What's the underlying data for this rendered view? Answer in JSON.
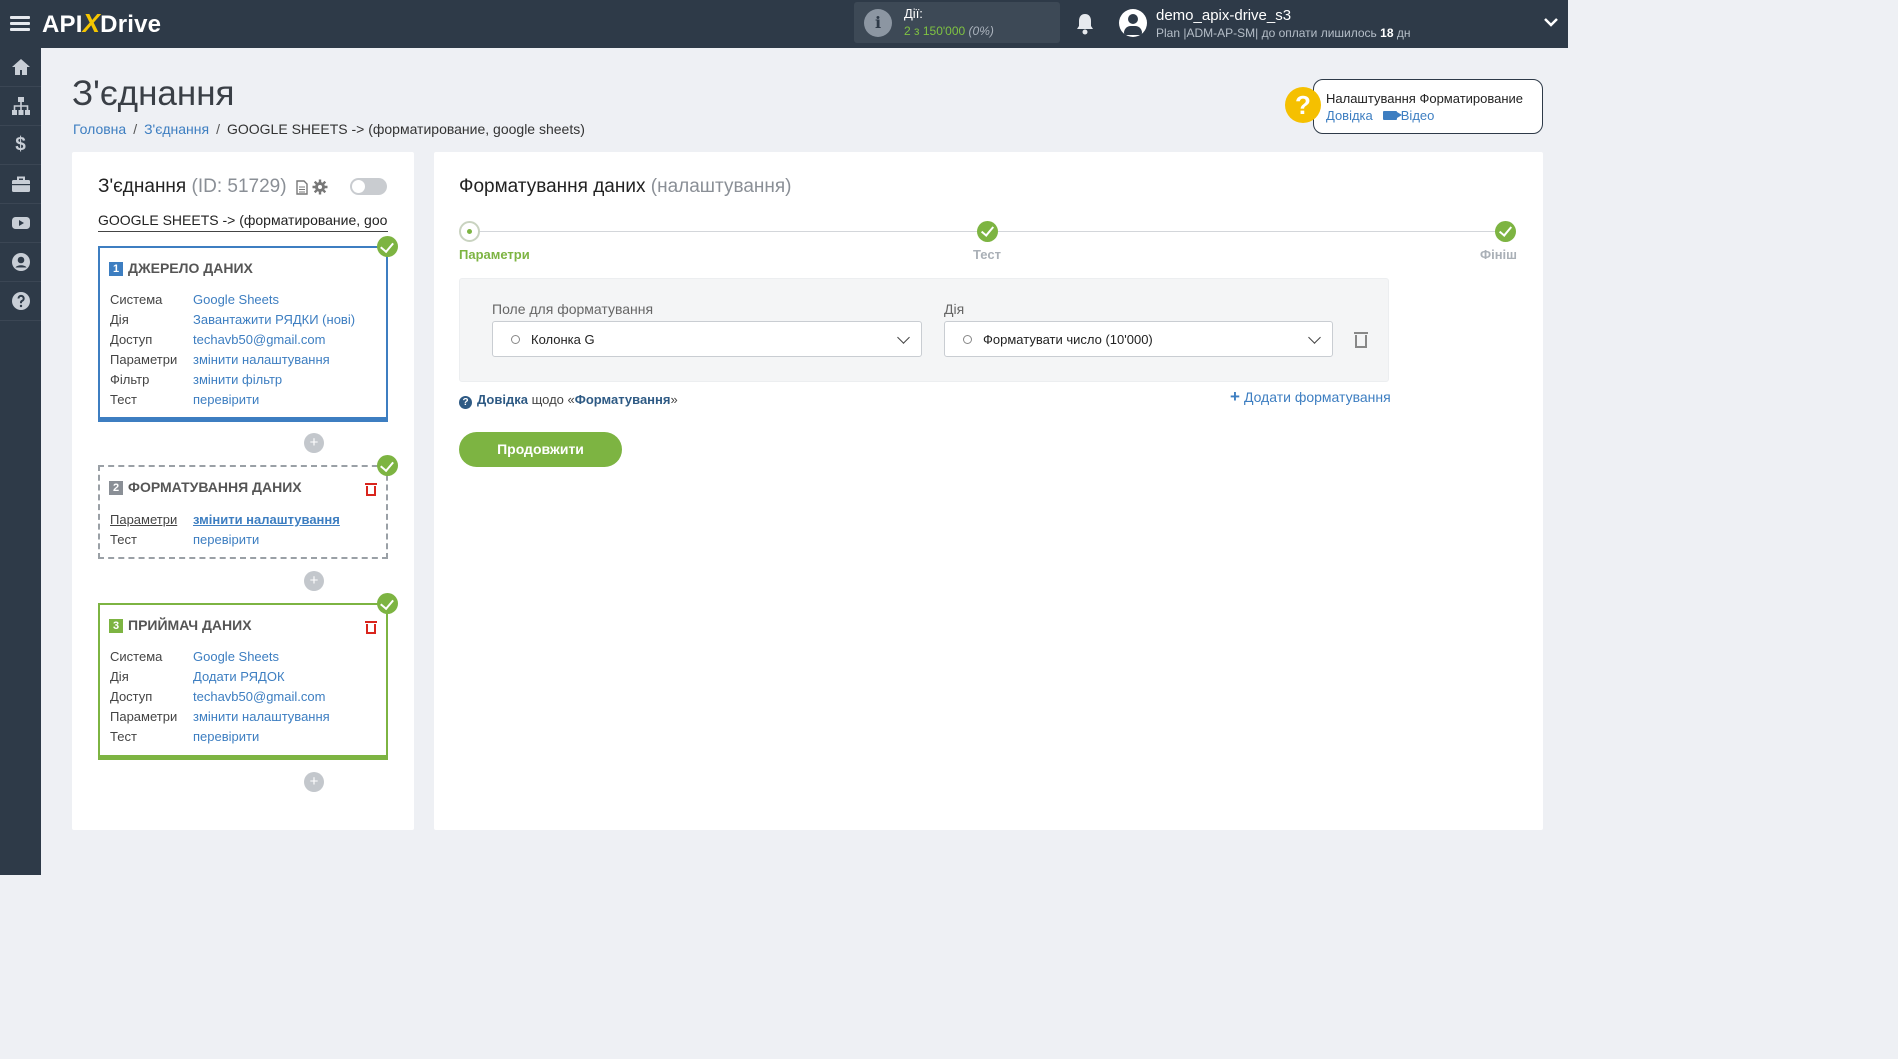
{
  "topbar": {
    "logo_left": "API",
    "logo_x": "X",
    "logo_right": "Drive",
    "actions_label": "Дії:",
    "actions_count": "2 з 150'000",
    "actions_percent": "(0%)",
    "username": "demo_apix-drive_s3",
    "plan_text": "Plan |ADM-AP-SM| до оплати лишилось",
    "plan_days": "18",
    "plan_days_unit": "дн"
  },
  "sidebar": {
    "items": [
      "home-icon",
      "sitemap-icon",
      "dollar-icon",
      "briefcase-icon",
      "youtube-icon",
      "user-icon",
      "help-icon"
    ],
    "dollar": "$"
  },
  "page": {
    "title": "З'єднання",
    "breadcrumb": [
      "Головна",
      "З'єднання",
      "GOOGLE SHEETS -> (форматирование, google sheets)"
    ]
  },
  "help_box": {
    "title": "Налаштування Форматирование",
    "link_help": "Довідка",
    "link_video": "Відео"
  },
  "left_panel": {
    "title": "З'єднання",
    "id_text": "(ID: 51729)",
    "subtitle": "GOOGLE SHEETS -> (форматирование, google sheets)",
    "cards": [
      {
        "num": "1",
        "header": "ДЖЕРЕЛО ДАНИХ",
        "rows": [
          {
            "k": "Система",
            "v": "Google Sheets"
          },
          {
            "k": "Дія",
            "v": "Завантажити РЯДКИ (нові)"
          },
          {
            "k": "Доступ",
            "v": "techavb50@gmail.com"
          },
          {
            "k": "Параметри",
            "v": "змінити налаштування"
          },
          {
            "k": "Фільтр",
            "v": "змінити фільтр"
          },
          {
            "k": "Тест",
            "v": "перевірити"
          }
        ]
      },
      {
        "num": "2",
        "header": "ФОРМАТУВАННЯ ДАНИХ",
        "rows": [
          {
            "k": "Параметри",
            "v": "змінити налаштування"
          },
          {
            "k": "Тест",
            "v": "перевірити"
          }
        ]
      },
      {
        "num": "3",
        "header": "ПРИЙМАЧ ДАНИХ",
        "rows": [
          {
            "k": "Система",
            "v": "Google Sheets"
          },
          {
            "k": "Дія",
            "v": "Додати РЯДОК"
          },
          {
            "k": "Доступ",
            "v": "techavb50@gmail.com"
          },
          {
            "k": "Параметри",
            "v": "змінити налаштування"
          },
          {
            "k": "Тест",
            "v": "перевірити"
          }
        ]
      }
    ],
    "add_symbol": "+"
  },
  "main": {
    "title": "Форматування даних",
    "title_sub": "(налаштування)",
    "steps": [
      "Параметри",
      "Тест",
      "Фініш"
    ],
    "field_label": "Поле для форматування",
    "field_value": "Колонка G",
    "action_label": "Дія",
    "action_value": "Форматувати число (10'000)",
    "help_prefix": "Довідка",
    "help_mid": "щодо «",
    "help_term": "Форматування",
    "help_end": "»",
    "add_format": "Додати форматування",
    "continue": "Продовжити"
  }
}
